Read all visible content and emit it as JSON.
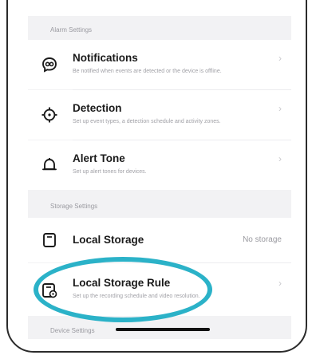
{
  "sections": {
    "alarm_settings": "Alarm Settings",
    "storage_settings": "Storage Settings",
    "device_settings": "Device Settings"
  },
  "items": {
    "notifications": {
      "title": "Notifications",
      "desc": "Be notified when events are detected or the device is offline.",
      "icon": "notification-icon"
    },
    "detection": {
      "title": "Detection",
      "desc": "Set up event types, a detection schedule and activity zones.",
      "icon": "crosshair-icon"
    },
    "alert_tone": {
      "title": "Alert Tone",
      "desc": "Set up alert tones for devices.",
      "icon": "bell-icon"
    },
    "local_storage": {
      "title": "Local Storage",
      "value": "No storage",
      "icon": "sd-card-icon"
    },
    "local_storage_rule": {
      "title": "Local Storage Rule",
      "desc": "Set up the recording schedule and video resolution.",
      "icon": "storage-rule-icon"
    }
  },
  "chevron": "›",
  "highlight_color": "#2bb2c8"
}
